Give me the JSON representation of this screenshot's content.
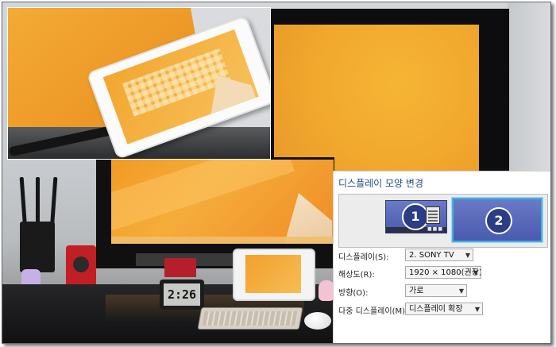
{
  "panel": {
    "title": "디스플레이 모양 변경",
    "monitors": [
      {
        "number": "1",
        "selected": false
      },
      {
        "number": "2",
        "selected": true
      }
    ],
    "fields": [
      {
        "label": "디스플레이(S):",
        "value": "2. SONY TV"
      },
      {
        "label": "해상도(R):",
        "value": "1920 × 1080(권장)"
      },
      {
        "label": "방향(O):",
        "value": "가로"
      },
      {
        "label": "다중 디스플레이(M):",
        "value": "디스플레이 확장"
      }
    ]
  },
  "photo": {
    "clock_reading": "2:26"
  },
  "colors": {
    "title_blue": "#1f4a8c",
    "monitor_fill": "#5566b8",
    "selected_border": "#3fb3e4",
    "wallpaper_orange": "#f2a42c"
  },
  "icons": {
    "dropdown": "chevron-down-icon"
  }
}
